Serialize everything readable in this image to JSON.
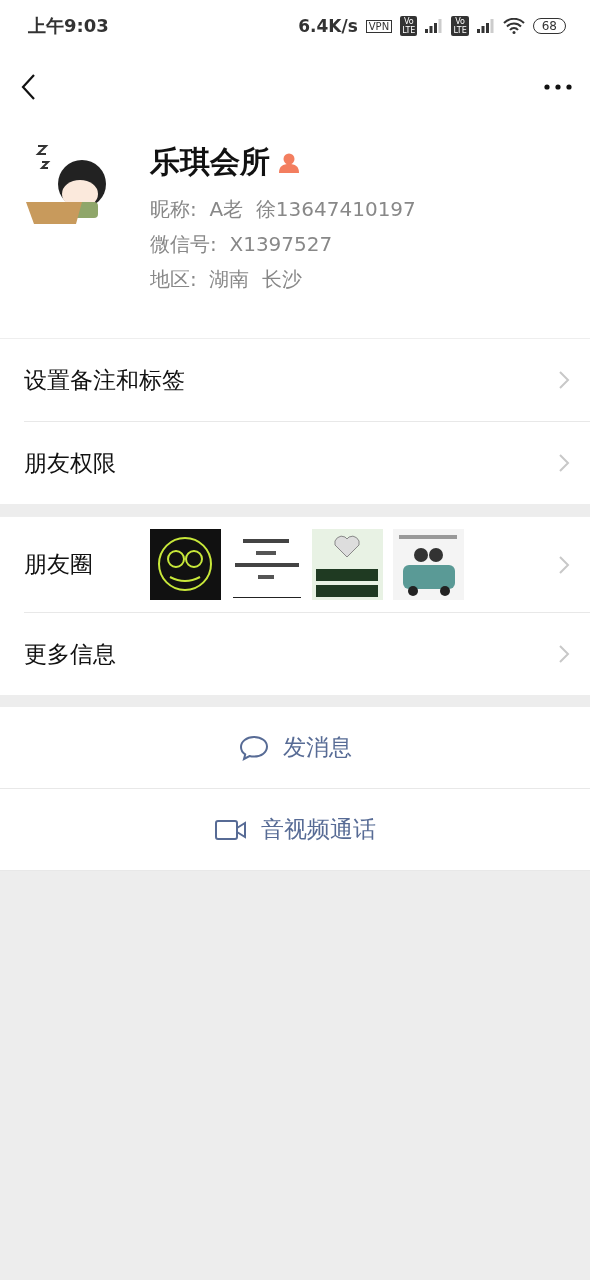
{
  "status_bar": {
    "time": "上午9:03",
    "speed": "6.4K/s",
    "vpn": "VPN",
    "sims": [
      {
        "top": "Vo",
        "bottom": "LTE"
      },
      {
        "top": "Vo",
        "bottom": "LTE"
      }
    ],
    "battery": "68"
  },
  "profile": {
    "name": "乐琪会所",
    "gender_badge": {
      "kind": "female"
    },
    "details": [
      "昵称:  A老  徐13647410197",
      "微信号:  X1397527",
      "地区:  湖南  长沙"
    ]
  },
  "groups": [
    {
      "rows": [
        {
          "kind": "plain",
          "label": "设置备注和标签"
        },
        {
          "kind": "plain",
          "label": "朋友权限"
        }
      ]
    },
    {
      "rows": [
        {
          "kind": "moments",
          "label": "朋友圈"
        },
        {
          "kind": "plain",
          "label": "更多信息"
        }
      ]
    }
  ],
  "actions": [
    {
      "kind": "message",
      "label": "发消息"
    },
    {
      "kind": "video",
      "label": "音视频通话"
    }
  ]
}
